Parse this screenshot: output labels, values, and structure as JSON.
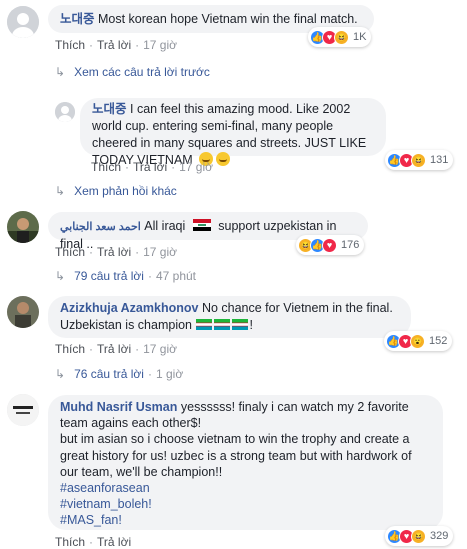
{
  "common": {
    "like": "Thích",
    "reply": "Trả lời",
    "sep": "·"
  },
  "comments": [
    {
      "author": "노대중",
      "text": "Most korean hope Vietnam win the final match.",
      "time": "17 giờ",
      "reactions": "1K"
    },
    {
      "author": "노대중",
      "text": "I can feel this amazing mood. Like 2002 world cup. entering semi-final, many people cheered in many squares and streets. JUST LIKE TODAY VIETNAM",
      "time": "17 giờ",
      "reactions": "131"
    },
    {
      "author": "احمد سعد الجنابي",
      "text_a": "All iraqi",
      "text_b": "support uzpekistan in final ..",
      "time": "17 giờ",
      "reactions": "176"
    },
    {
      "author": "Azizkhuja Azamkhonov",
      "text": "No chance for Vietnem in the final.",
      "text2": "Uzbekistan is champion",
      "text2_end": "!",
      "time": "17 giờ",
      "reactions": "152"
    },
    {
      "author": "Muhd Nasrif Usman",
      "text": "yessssss! finaly i can watch my 2 favorite team agains each other$!",
      "text2": "but im asian so i choose vietnam to win the trophy and create a great history for us! uzbec is a strong team but with hardwork of our team, we'll be champion!!",
      "tag1": "#aseanforasean",
      "tag2": "#vietnam_boleh!",
      "tag3": "#MAS_fan!",
      "reactions": "329"
    }
  ],
  "reply_links": {
    "prev": "Xem các câu trả lời trước",
    "more": "Xem phản hồi khác",
    "r3": {
      "label": "79 câu trả lời",
      "time": "47 phút"
    },
    "r4": {
      "label": "76 câu trả lời",
      "time": "1 giờ"
    }
  },
  "colors": {
    "link": "#385898",
    "bubble": "#f2f3f5",
    "like": "#2d88ff",
    "love": "#f02849",
    "haha": "#f7b125"
  },
  "icons": [
    "like-icon",
    "love-icon",
    "haha-icon",
    "wow-icon",
    "reply-arrow-icon",
    "grin-emoji",
    "iraq-flag",
    "uzbekistan-flag"
  ]
}
